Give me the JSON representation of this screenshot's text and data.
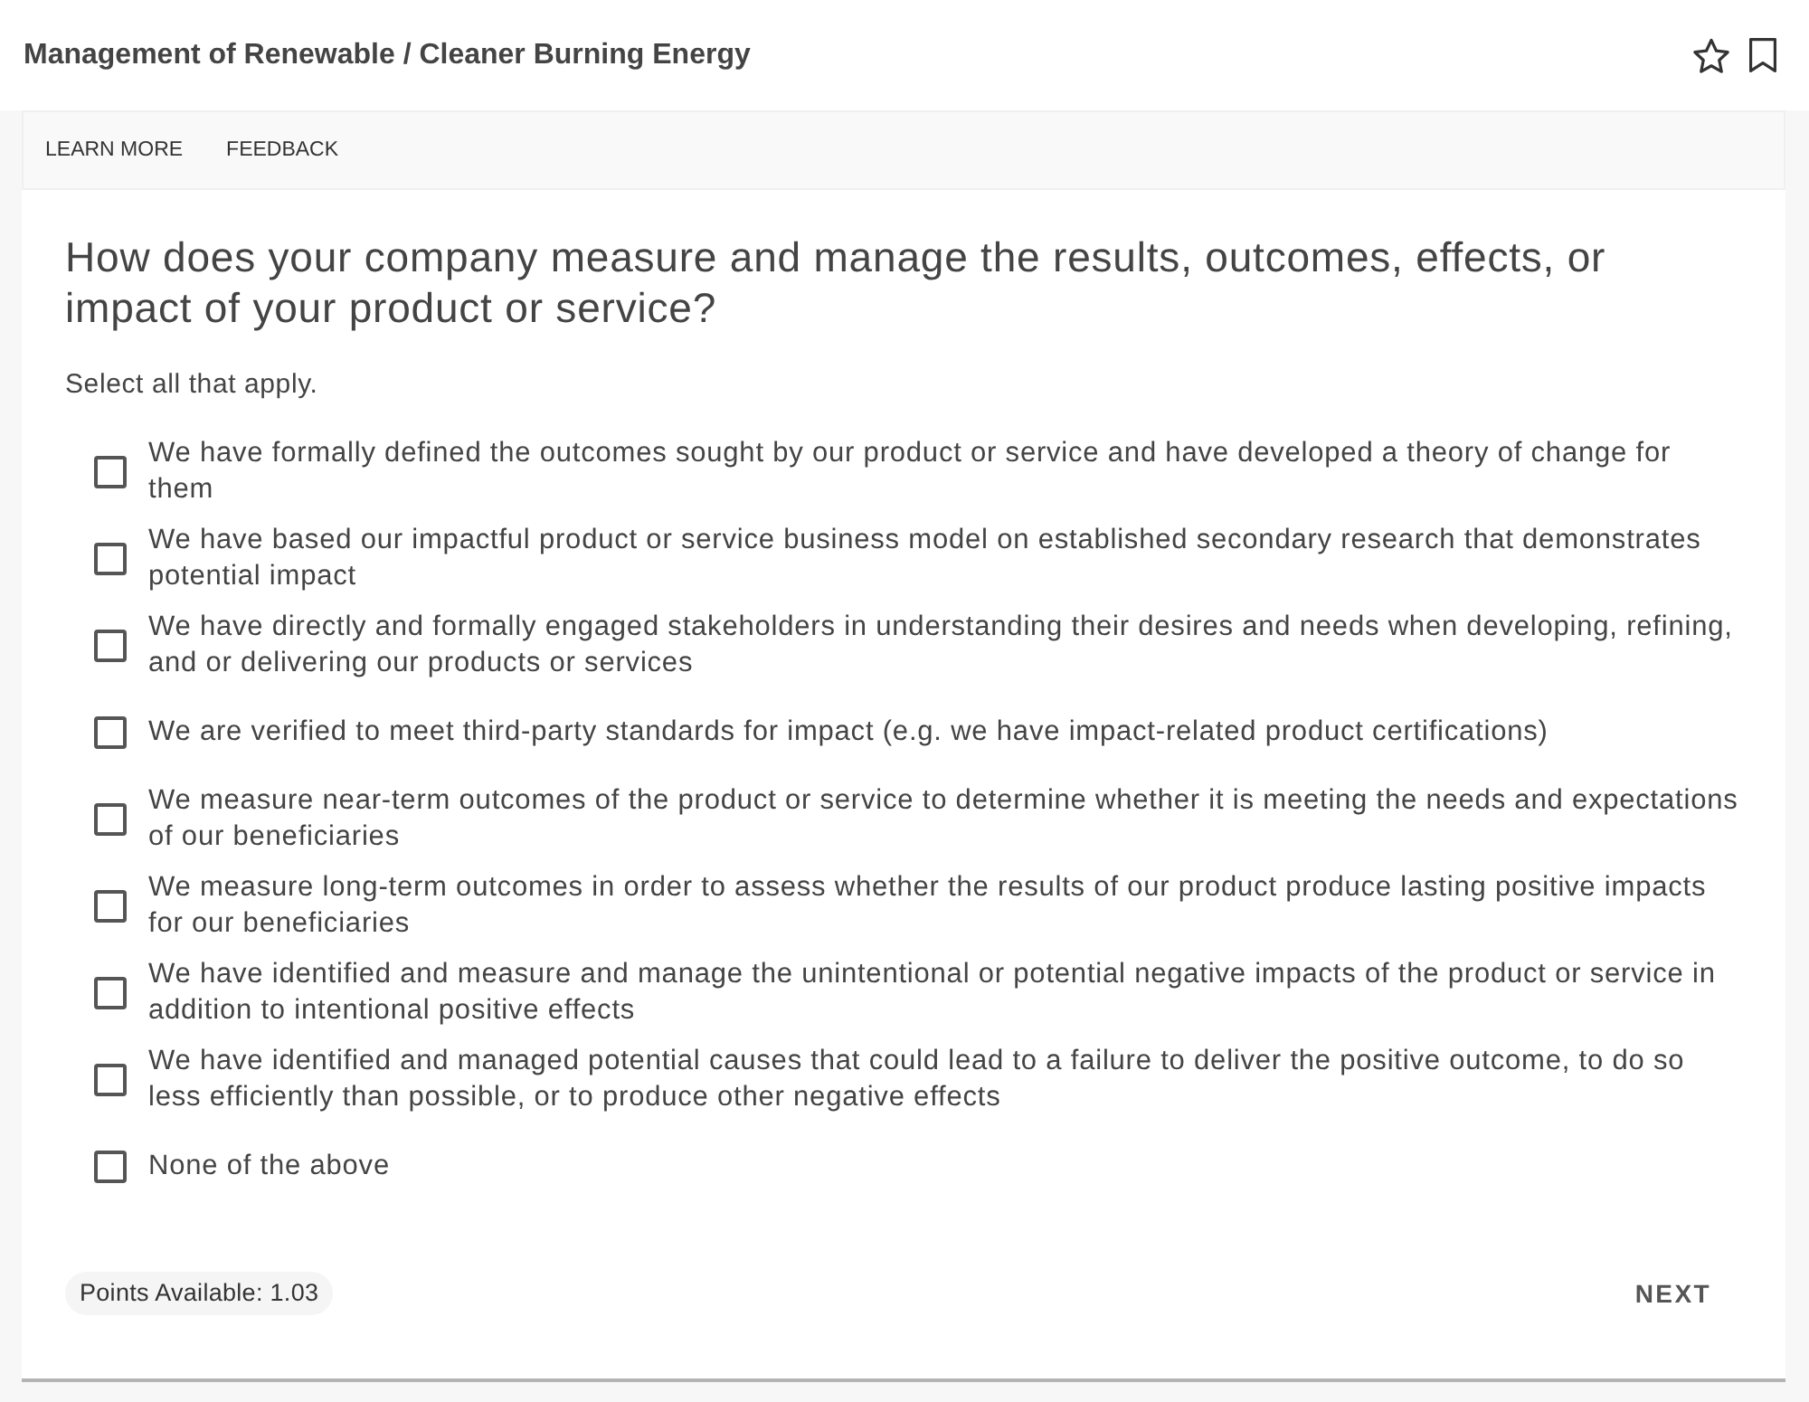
{
  "header": {
    "title": "Management of Renewable / Cleaner Burning Energy"
  },
  "nav": {
    "links": [
      "LEARN MORE",
      "FEEDBACK"
    ]
  },
  "question": {
    "title": "How does your company measure and manage the results, outcomes, effects, or impact of your product or service?",
    "instruction": "Select all that apply.",
    "options": [
      {
        "label": "We have formally defined the outcomes sought by our product or service and have developed a theory of change for them",
        "checked": false
      },
      {
        "label": "We have based our impactful product or service business model on established secondary research that demonstrates potential impact",
        "checked": false
      },
      {
        "label": "We have directly and formally engaged stakeholders in understanding their desires and needs when developing, refining, and or delivering our products or services",
        "checked": false
      },
      {
        "label": "We are verified to meet third-party standards for impact (e.g. we have impact-related product certifications)",
        "checked": false
      },
      {
        "label": "We measure near-term outcomes of the product or service to determine whether it is meeting the needs and expectations of our beneficiaries",
        "checked": false
      },
      {
        "label": "We measure long-term outcomes in order to assess whether the results of our product produce lasting positive impacts for our beneficiaries",
        "checked": false
      },
      {
        "label": "We have identified and measure and manage the unintentional or potential negative impacts of the product or service in addition to intentional positive effects",
        "checked": false
      },
      {
        "label": "We have identified and managed potential causes that could lead to a failure to deliver the positive outcome, to do so less efficiently than possible, or to produce other negative effects",
        "checked": false
      },
      {
        "label": "None of the above",
        "checked": false
      }
    ]
  },
  "footer": {
    "points": "Points Available: 1.03",
    "next_button": "NEXT"
  }
}
